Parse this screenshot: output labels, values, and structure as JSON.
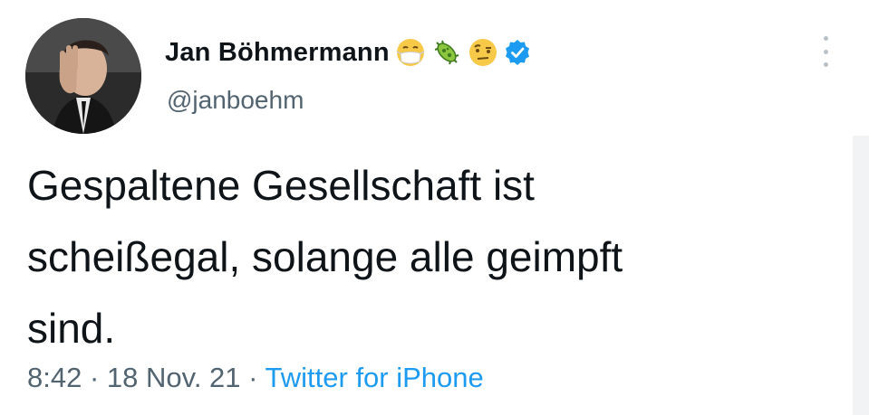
{
  "tweet": {
    "author": {
      "display_name": "Jan Böhmermann",
      "handle": "@janboehm",
      "avatar_icon": "profile-photo",
      "name_emojis": [
        "face-with-medical-mask-icon",
        "microbe-icon",
        "face-with-raised-eyebrow-icon"
      ],
      "verified": true
    },
    "text": "Gespaltene Gesellschaft ist\nscheißegal, solange alle geimpft\nsind.",
    "time": "8:42",
    "separator": " · ",
    "date": "18 Nov. 21",
    "source": "Twitter for iPhone"
  },
  "colors": {
    "text": "#0f1419",
    "secondary": "#536471",
    "accent": "#1d9bf0",
    "verified_badge": "#1d9bf0"
  }
}
